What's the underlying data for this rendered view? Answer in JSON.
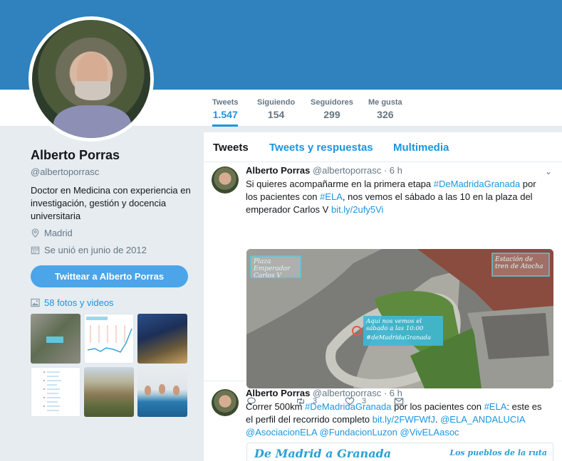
{
  "profile": {
    "name": "Alberto Porras",
    "handle": "@albertoporrasc",
    "bio": "Doctor en Medicina con experiencia en investigación, gestión y docencia universitaria",
    "location": "Madrid",
    "joined": "Se unió en junio de 2012",
    "tweet_to_label": "Twittear a Alberto Porras",
    "photos_label": "58 fotos y videos"
  },
  "stats": [
    {
      "label": "Tweets",
      "value": "1.547"
    },
    {
      "label": "Siguiendo",
      "value": "154"
    },
    {
      "label": "Seguidores",
      "value": "299"
    },
    {
      "label": "Me gusta",
      "value": "326"
    }
  ],
  "timeline_tabs": [
    "Tweets",
    "Tweets y respuestas",
    "Multimedia"
  ],
  "tweets": [
    {
      "name": "Alberto Porras",
      "handle": "@albertoporrasc",
      "time": "· 6 h",
      "text_1": "Si quieres acompañarme en la primera etapa ",
      "tag_1": "#DeMadridaGranada",
      "text_2": " por los pacientes con ",
      "tag_2": "#ELA",
      "text_3": ", nos vemos el sábado a las 10 en la plaza del emperador Carlos V ",
      "link": "bit.ly/2ufy5Vi",
      "media_labels": {
        "plaza": "Plaza Emperador Carlos V",
        "station": "Estación de tren de Atocha",
        "meet": "Aquí nos vemos el sábado a las 10:00",
        "meet_tag": "#deMadridaGranada"
      },
      "retweets": "3",
      "likes": "3"
    },
    {
      "name": "Alberto Porras",
      "handle": "@albertoporrasc",
      "time": "· 6 h",
      "text_1": "Correr 500km ",
      "tag_1": "#DeMadridaGranada",
      "text_2": " por los pacientes con ",
      "tag_2": "#ELA",
      "text_3": ": este es el perfil del recorrido completo ",
      "link": "bit.ly/2FWFWfJ",
      "mention_1": "@ELA_ANDALUCIA",
      "mention_2": "@AsociacionELA",
      "mention_3": "@FundacionLuzon",
      "mention_4": "@VivELAasoc",
      "media_title": "De Madrid a Granada",
      "media_right": "Los pueblos de la ruta"
    }
  ]
}
